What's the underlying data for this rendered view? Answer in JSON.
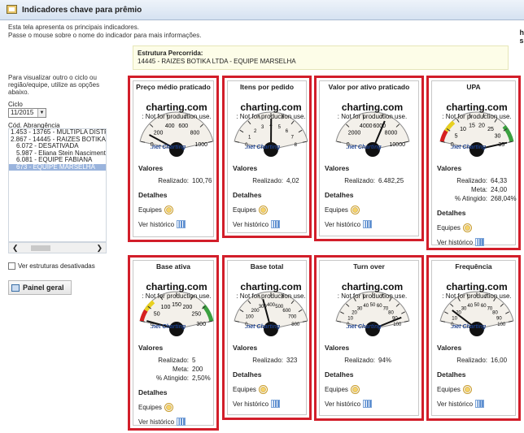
{
  "window": {
    "title": "Indicadores chave para prêmio"
  },
  "intro": {
    "line1": "Esta tela apresenta os principais indicadores.",
    "line2": "Passe o mouse sobre o nome do indicador para mais informações."
  },
  "edge_text": {
    "line1": "h",
    "line2": "s"
  },
  "estrutura": {
    "label": "Estrutura Percorrida:",
    "value": "14445 - RAIZES BOTIKA LTDA - EQUIPE MARSELHA"
  },
  "left": {
    "hint_lines": [
      "Para visualizar outro o ciclo ou",
      "região/equipe, utilize as opções",
      "abaixo."
    ],
    "ciclo_label": "Ciclo",
    "ciclo_value": "11/2015",
    "cod_label": "Cód. Abrangência",
    "tree": [
      "1.453 - 13765 - MULTIPLA DISTRI",
      "2.867 - 14445 - RAIZES BOTIKA LT",
      "6.072 - DESATIVADA",
      "5.987 - Eliana Stein Nascimento",
      "6.081 - EQUIPE FABIANA",
      "673 - EQUIPE MARSELHA"
    ],
    "show_disabled_label": "Ver estruturas desativadas",
    "painel_label": "Painel geral"
  },
  "common": {
    "charting": "charting.com",
    "not_prod": ": Not for production use.",
    "netcharting": ".net Charting",
    "valores": "Valores",
    "detalhes": "Detalhes",
    "equipes": "Equipes",
    "historico": "Ver histórico"
  },
  "cards": [
    {
      "title": "Preço médio praticado",
      "rows": [
        {
          "label": "Realizado:",
          "value": "100,76"
        }
      ],
      "gauge": {
        "ticks": [
          "0",
          "200",
          "400",
          "600",
          "800",
          "1000"
        ],
        "value": 100.76,
        "max": 1000,
        "colored": false
      }
    },
    {
      "title": "Itens por pedido",
      "rows": [
        {
          "label": "Realizado:",
          "value": "4,02"
        }
      ],
      "gauge": {
        "ticks": [
          "0",
          "1",
          "2",
          "3",
          "4",
          "5",
          "6",
          "7",
          "8"
        ],
        "value": 4.02,
        "max": 8,
        "colored": false
      }
    },
    {
      "title": "Valor por ativo praticado",
      "rows": [
        {
          "label": "Realizado:",
          "value": "6.482,25"
        }
      ],
      "gauge": {
        "ticks": [
          "0",
          "2000",
          "4000",
          "6000",
          "8000",
          "10000"
        ],
        "value": 6482.25,
        "max": 10000,
        "colored": false
      }
    },
    {
      "title": "UPA",
      "rows": [
        {
          "label": "Realizado:",
          "value": "64,33"
        },
        {
          "label": "Meta:",
          "value": "24,00"
        },
        {
          "label": "% Atingido:",
          "value": "268,04%"
        }
      ],
      "gauge": {
        "ticks": [
          "0",
          "5",
          "10",
          "15",
          "20",
          "25",
          "30",
          "35"
        ],
        "value": 35,
        "max": 35,
        "colored": true
      }
    },
    {
      "title": "Base ativa",
      "rows": [
        {
          "label": "Realizado:",
          "value": "5"
        },
        {
          "label": "Meta:",
          "value": "200"
        },
        {
          "label": "% Atingido:",
          "value": "2,50%"
        }
      ],
      "gauge": {
        "ticks": [
          "0",
          "50",
          "100",
          "150",
          "200",
          "250",
          "300"
        ],
        "value": 5,
        "max": 300,
        "colored": true
      }
    },
    {
      "title": "Base total",
      "rows": [
        {
          "label": "Realizado:",
          "value": "323"
        }
      ],
      "gauge": {
        "ticks": [
          "0",
          "100",
          "200",
          "300",
          "400",
          "500",
          "600",
          "700",
          "800"
        ],
        "value": 323,
        "max": 800,
        "colored": false
      }
    },
    {
      "title": "Turn over",
      "rows": [
        {
          "label": "Realizado:",
          "value": "94%"
        }
      ],
      "gauge": {
        "ticks": [
          "0",
          "10",
          "20",
          "30",
          "40",
          "50",
          "60",
          "70",
          "80",
          "90",
          "100"
        ],
        "value": 94,
        "max": 100,
        "colored": false
      }
    },
    {
      "title": "Frequência",
      "rows": [
        {
          "label": "Realizado:",
          "value": "16,00"
        }
      ],
      "gauge": {
        "ticks": [
          "0",
          "10",
          "20",
          "30",
          "40",
          "50",
          "60",
          "70",
          "80",
          "90",
          "100"
        ],
        "value": 16,
        "max": 100,
        "colored": false
      }
    }
  ]
}
